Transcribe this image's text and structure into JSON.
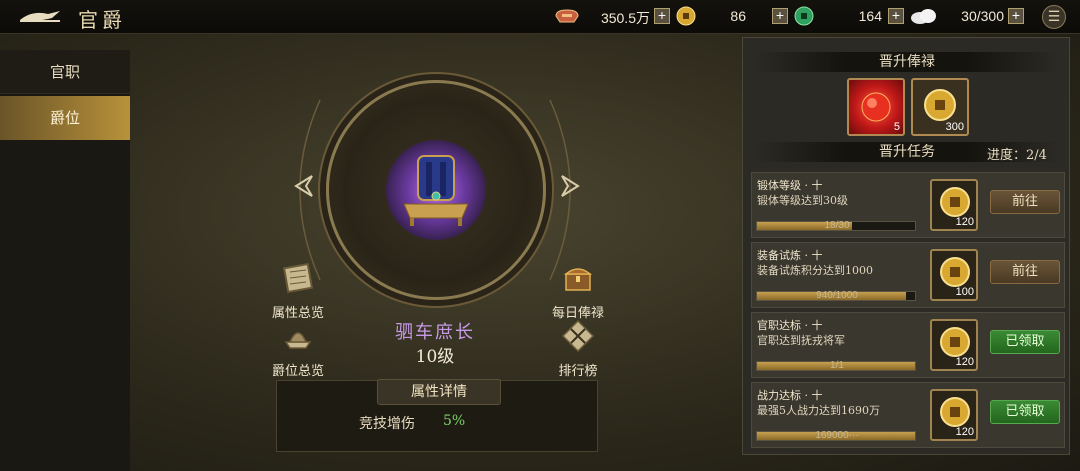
{
  "header": {
    "title": "官爵"
  },
  "resources": [
    {
      "icon": "silver-ingot-icon",
      "value": "350.5万"
    },
    {
      "icon": "gold-coin-icon",
      "value": "86"
    },
    {
      "icon": "jade-coin-icon",
      "value": "164"
    },
    {
      "icon": "stamina-cloud-icon",
      "value": "30/300"
    }
  ],
  "nav": {
    "items": [
      {
        "label": "官职"
      },
      {
        "label": "爵位"
      }
    ],
    "selected_index": 1
  },
  "rank": {
    "name": "驷车庶长",
    "level": "10级"
  },
  "side_buttons": {
    "attr_overview": "属性总览",
    "rank_overview": "爵位总览",
    "daily_salary": "每日俸禄",
    "leaderboard": "排行榜"
  },
  "detail": {
    "header": "属性详情",
    "key": "竞技增伤",
    "value": "5%"
  },
  "right": {
    "salary_header": "晋升俸禄",
    "rewards": [
      {
        "icon": "red-orb-icon",
        "count": "5"
      },
      {
        "icon": "gold-coin-icon",
        "count": "300"
      }
    ],
    "tasks_header": "晋升任务",
    "progress_label": "进度：2/4",
    "tasks": [
      {
        "name": "锻体等级 · 十",
        "desc": "锻体等级达到30级",
        "progress": 0.6,
        "progress_text": "18/30",
        "reward": "120",
        "button": "前往",
        "state": "go"
      },
      {
        "name": "装备试炼 · 十",
        "desc": "装备试炼积分达到1000",
        "progress": 0.94,
        "progress_text": "940/1000",
        "reward": "100",
        "button": "前往",
        "state": "go"
      },
      {
        "name": "官职达标 · 十",
        "desc": "官职达到抚戎将军",
        "progress": 1.0,
        "progress_text": "1/1",
        "reward": "120",
        "button": "已领取",
        "state": "done"
      },
      {
        "name": "战力达标 · 十",
        "desc": "最强5人战力达到1690万",
        "progress": 1.0,
        "progress_text": "169000···",
        "reward": "120",
        "button": "已领取",
        "state": "done"
      }
    ]
  },
  "colors": {
    "accent_gold": "#b8923a",
    "rank_purple": "#c79ae8",
    "value_green": "#7ad064",
    "done_green": "#3a8a34"
  }
}
